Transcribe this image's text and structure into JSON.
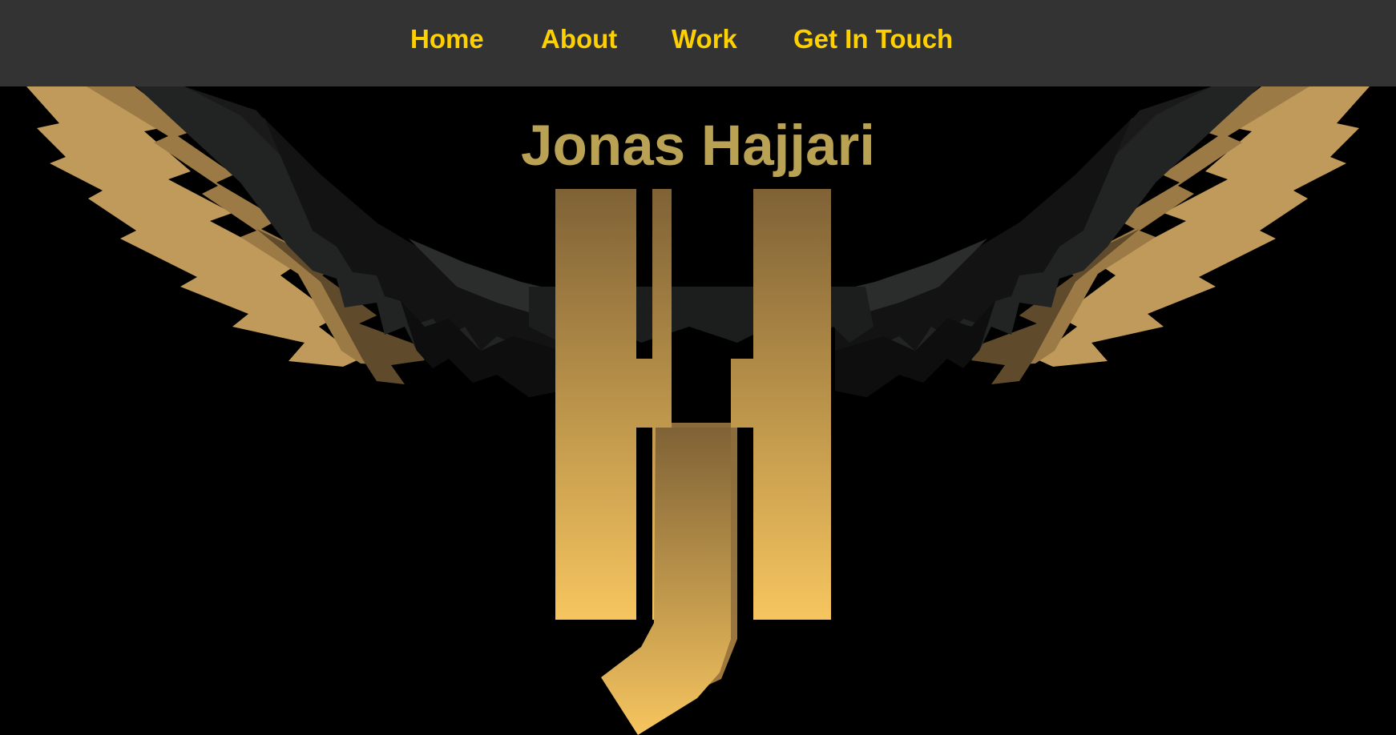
{
  "nav": {
    "items": [
      {
        "label": "Home"
      },
      {
        "label": "About"
      },
      {
        "label": "Work"
      },
      {
        "label": "Get In Touch"
      }
    ]
  },
  "hero": {
    "name": "Jonas Hajjari",
    "logo_letters": "HJ"
  },
  "colors": {
    "nav_background": "#333333",
    "nav_link": "#ffd000",
    "page_background": "#000000",
    "title": "#b9a253",
    "logo_gradient_top": "#7f6236",
    "logo_gradient_bottom": "#f6c55f"
  },
  "icons": [
    "eagle-wings-emblem"
  ]
}
